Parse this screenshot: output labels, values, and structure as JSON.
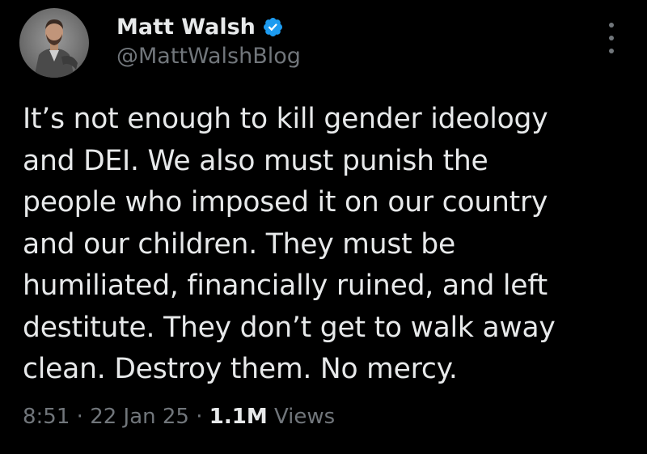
{
  "author": {
    "display_name": "Matt Walsh",
    "handle": "@MattWalshBlog",
    "verified_icon": "verified-badge-icon",
    "avatar_icon": "profile-photo-icon"
  },
  "more_icon": "more-vertical-icon",
  "tweet": {
    "lines": [
      "It’s not enough to kill gender ideology",
      "and DEI. We also must punish the",
      "people who imposed it on our country",
      "and our children. They must be",
      "humiliated, financially ruined, and left",
      "destitute. They don’t get to walk away",
      "clean. Destroy them. No mercy."
    ]
  },
  "meta": {
    "time": "8:51",
    "separator": "·",
    "date": "22 Jan 25",
    "views_count": "1.1M",
    "views_label": "Views"
  },
  "colors": {
    "background": "#000000",
    "text_primary": "#e7e9ea",
    "text_secondary": "#71767b",
    "verified_blue": "#1d9bf0"
  }
}
